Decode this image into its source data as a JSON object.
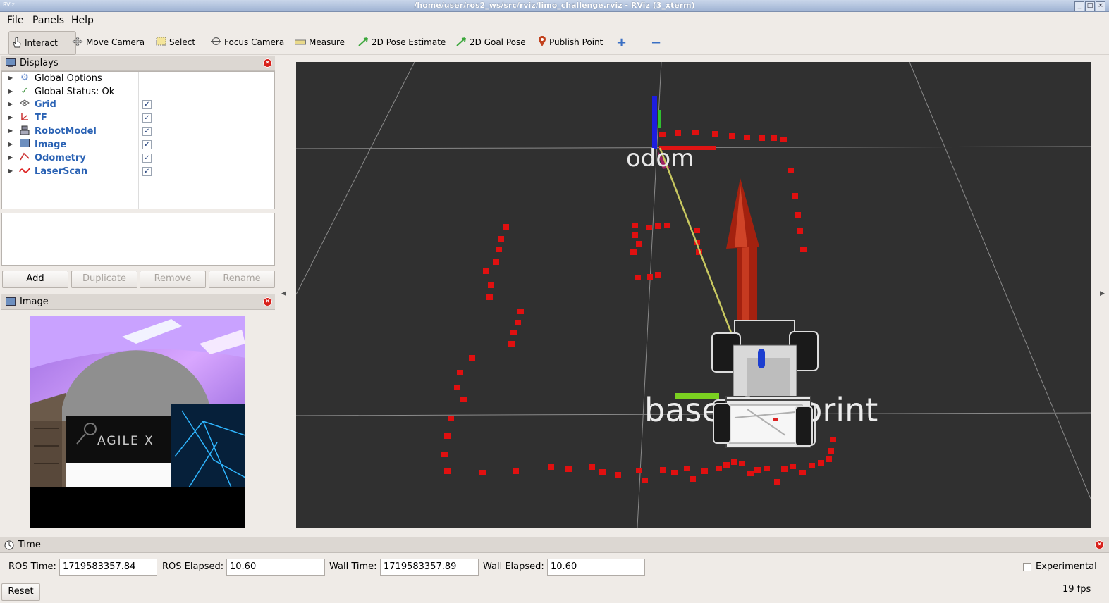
{
  "window": {
    "title": "/home/user/ros2_ws/src/rviz/limo_challenge.rviz - RViz (3_xterm)",
    "app_icon_text": "RViz",
    "buttons": [
      "_",
      "□",
      "×"
    ]
  },
  "menu": [
    "File",
    "Panels",
    "Help"
  ],
  "toolbar": {
    "tools": [
      {
        "label": "Interact",
        "icon": "hand-icon",
        "active": true
      },
      {
        "label": "Move Camera",
        "icon": "move-camera-icon"
      },
      {
        "label": "Select",
        "icon": "select-icon"
      },
      {
        "label": "Focus Camera",
        "icon": "focus-camera-icon"
      },
      {
        "label": "Measure",
        "icon": "ruler-icon"
      },
      {
        "label": "2D Pose Estimate",
        "icon": "pose-estimate-icon"
      },
      {
        "label": "2D Goal Pose",
        "icon": "goal-pose-icon"
      },
      {
        "label": "Publish Point",
        "icon": "pin-icon"
      }
    ],
    "add_tool": "+",
    "remove_tool": "−"
  },
  "displays": {
    "title": "Displays",
    "items": [
      {
        "name": "Global Options",
        "icon": "gear-icon",
        "checkbox": false
      },
      {
        "name": "Global Status: Ok",
        "icon": "check-icon",
        "checkbox": false
      },
      {
        "name": "Grid",
        "icon": "grid-icon",
        "checkbox": true,
        "checked": true
      },
      {
        "name": "TF",
        "icon": "tf-icon",
        "checkbox": true,
        "checked": true
      },
      {
        "name": "RobotModel",
        "icon": "robot-icon",
        "checkbox": true,
        "checked": true
      },
      {
        "name": "Image",
        "icon": "image-icon",
        "checkbox": true,
        "checked": true
      },
      {
        "name": "Odometry",
        "icon": "odometry-icon",
        "checkbox": true,
        "checked": true
      },
      {
        "name": "LaserScan",
        "icon": "laserscan-icon",
        "checkbox": true,
        "checked": true
      }
    ],
    "buttons": {
      "add": "Add",
      "duplicate": "Duplicate",
      "remove": "Remove",
      "rename": "Rename"
    }
  },
  "image_panel": {
    "title": "Image",
    "camera_text": "AGILE X"
  },
  "viewport": {
    "frame_labels": {
      "odom": "odom",
      "base": "base_footprint"
    }
  },
  "time": {
    "title": "Time",
    "ros_time_label": "ROS Time:",
    "ros_time": "1719583357.84",
    "ros_elapsed_label": "ROS Elapsed:",
    "ros_elapsed": "10.60",
    "wall_time_label": "Wall Time:",
    "wall_time": "1719583357.89",
    "wall_elapsed_label": "Wall Elapsed:",
    "wall_elapsed": "10.60",
    "experimental_label": "Experimental",
    "reset_label": "Reset",
    "fps": "19 fps"
  },
  "colors": {
    "laser": "#e01010",
    "background": "#303030",
    "blue_label": "#2a62b4"
  }
}
